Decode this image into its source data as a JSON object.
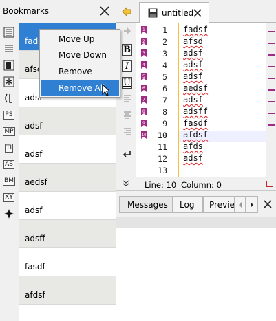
{
  "bookmarks_panel": {
    "title": "Bookmarks",
    "tools": [
      "list-icon",
      "list-lines-icon",
      "bookmark-frame-icon",
      "asterisk-icon",
      "bracket-icon",
      "PS",
      "MP",
      "TI",
      "AS",
      "BM",
      "XY",
      "sparkle-icon"
    ],
    "tool_labels": {
      "ps": "PS",
      "mp": "MP",
      "ti": "TI",
      "as": "AS",
      "bm": "BM",
      "xy": "XY"
    },
    "items": [
      "fadsf",
      "afsd",
      "adsf",
      "adsf",
      "adsf",
      "aedsf",
      "adsf",
      "adsff",
      "fasdf",
      "afdsf"
    ]
  },
  "context_menu": {
    "items": [
      "Move Up",
      "Move Down",
      "Remove",
      "Remove All"
    ],
    "highlighted": "Remove All"
  },
  "editor": {
    "tab_title": "untitled",
    "line_numbers": [
      "1",
      "2",
      "3",
      "4",
      "5",
      "6",
      "7",
      "8",
      "9",
      "10",
      "11",
      "12",
      "13"
    ],
    "lines": [
      "fadsf",
      "afsd",
      "adsf",
      "adsf",
      "adsf",
      "aedsf",
      "adsf",
      "adsff",
      "fasdf",
      "afdsf",
      "afds",
      "adsf",
      ""
    ],
    "current_line": 10,
    "format_buttons": [
      "B",
      "I",
      "U"
    ]
  },
  "status": {
    "line_text": "Line: 10",
    "column_text": "Column: 0"
  },
  "messages": {
    "tabs": [
      "Messages",
      "Log",
      "Previe"
    ]
  },
  "colors": {
    "selection": "#2f7fd3",
    "bookmark_mark": "#a12a85",
    "edit_bar": "#f2c33a",
    "spell_underline": "#dd2222"
  }
}
